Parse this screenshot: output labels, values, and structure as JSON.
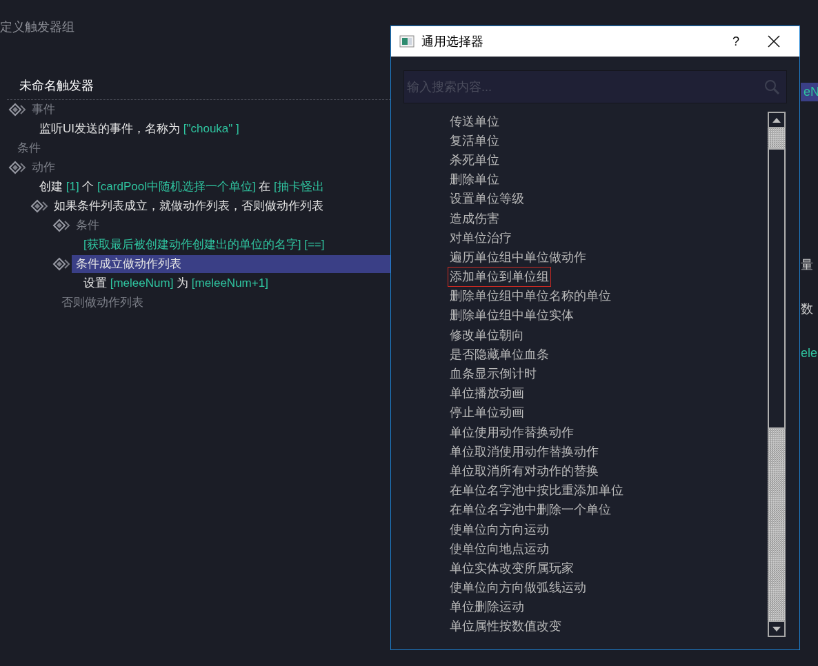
{
  "panel": {
    "heading": "定义触发器组",
    "trigger_name": "未命名触发器",
    "tree": [
      {
        "kind": "group",
        "muted": true,
        "selected": false,
        "parts": [
          {
            "text": "事件",
            "param": false
          }
        ],
        "children": [
          {
            "kind": "leaf",
            "muted": false,
            "selected": false,
            "parts": [
              {
                "text": "监听UI发送的事件，名称为 ",
                "param": false
              },
              {
                "text": "[\"chouka\" ]",
                "param": true
              }
            ]
          }
        ]
      },
      {
        "kind": "leaf",
        "muted": true,
        "selected": false,
        "parts": [
          {
            "text": "条件",
            "param": false
          }
        ]
      },
      {
        "kind": "group",
        "muted": true,
        "selected": false,
        "parts": [
          {
            "text": "动作",
            "param": false
          }
        ],
        "children": [
          {
            "kind": "leaf",
            "muted": false,
            "selected": false,
            "parts": [
              {
                "text": "创建 ",
                "param": false
              },
              {
                "text": "[1]",
                "param": true
              },
              {
                "text": " 个 ",
                "param": false
              },
              {
                "text": "[cardPool中随机选择一个单位]",
                "param": true
              },
              {
                "text": " 在 ",
                "param": false
              },
              {
                "text": "[抽卡怪出",
                "param": true
              }
            ]
          },
          {
            "kind": "group",
            "muted": false,
            "selected": false,
            "parts": [
              {
                "text": "如果条件列表成立，就做动作列表，否则做动作列表",
                "param": false
              }
            ],
            "children": [
              {
                "kind": "group",
                "muted": true,
                "selected": false,
                "parts": [
                  {
                    "text": "条件",
                    "param": false
                  }
                ],
                "children": [
                  {
                    "kind": "leaf",
                    "muted": false,
                    "selected": false,
                    "parts": [
                      {
                        "text": "[获取最后被创建动作创建出的单位的名字] [==]",
                        "param": true
                      }
                    ]
                  }
                ]
              },
              {
                "kind": "group",
                "muted": false,
                "selected": true,
                "parts": [
                  {
                    "text": "条件成立做动作列表",
                    "param": false
                  }
                ],
                "children": [
                  {
                    "kind": "leaf",
                    "muted": false,
                    "selected": false,
                    "parts": [
                      {
                        "text": "设置 ",
                        "param": false
                      },
                      {
                        "text": "[meleeNum]",
                        "param": true
                      },
                      {
                        "text": " 为 ",
                        "param": false
                      },
                      {
                        "text": "[meleeNum+1]",
                        "param": true
                      }
                    ]
                  }
                ]
              },
              {
                "kind": "leaf",
                "muted": true,
                "selected": false,
                "parts": [
                  {
                    "text": "否则做动作列表",
                    "param": false
                  }
                ]
              }
            ]
          }
        ]
      }
    ]
  },
  "side_fragments": [
    {
      "text": "eN",
      "kind": "chip"
    },
    {
      "text": "量",
      "kind": "label"
    },
    {
      "text": "数",
      "kind": "label"
    },
    {
      "text": "ele",
      "kind": "param"
    }
  ],
  "dialog": {
    "title": "通用选择器",
    "help": "?",
    "search": {
      "placeholder": "输入搜索内容..."
    },
    "items": [
      {
        "label": "传送单位",
        "marked": false
      },
      {
        "label": "复活单位",
        "marked": false
      },
      {
        "label": "杀死单位",
        "marked": false
      },
      {
        "label": "删除单位",
        "marked": false
      },
      {
        "label": "设置单位等级",
        "marked": false
      },
      {
        "label": "造成伤害",
        "marked": false
      },
      {
        "label": "对单位治疗",
        "marked": false
      },
      {
        "label": "遍历单位组中单位做动作",
        "marked": false
      },
      {
        "label": "添加单位到单位组",
        "marked": true
      },
      {
        "label": "删除单位组中单位名称的单位",
        "marked": false
      },
      {
        "label": "删除单位组中单位实体",
        "marked": false
      },
      {
        "label": "修改单位朝向",
        "marked": false
      },
      {
        "label": "是否隐藏单位血条",
        "marked": false
      },
      {
        "label": "血条显示倒计时",
        "marked": false
      },
      {
        "label": "单位播放动画",
        "marked": false
      },
      {
        "label": "停止单位动画",
        "marked": false
      },
      {
        "label": "单位使用动作替换动作",
        "marked": false
      },
      {
        "label": "单位取消使用动作替换动作",
        "marked": false
      },
      {
        "label": "单位取消所有对动作的替换",
        "marked": false
      },
      {
        "label": "在单位名字池中按比重添加单位",
        "marked": false
      },
      {
        "label": "在单位名字池中删除一个单位",
        "marked": false
      },
      {
        "label": "使单位向方向运动",
        "marked": false
      },
      {
        "label": "使单位向地点运动",
        "marked": false
      },
      {
        "label": "单位实体改变所属玩家",
        "marked": false
      },
      {
        "label": "使单位向方向做弧线运动",
        "marked": false
      },
      {
        "label": "单位删除运动",
        "marked": false
      },
      {
        "label": "单位属性按数值改变",
        "marked": false
      }
    ]
  }
}
